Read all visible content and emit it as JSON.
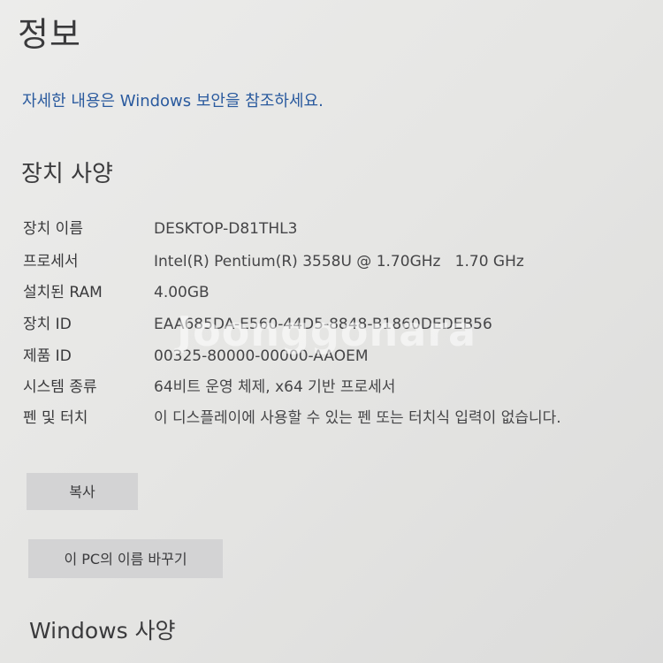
{
  "header": {
    "title": "정보",
    "security_link": "자세한 내용은 Windows 보안을 참조하세요."
  },
  "device_specs": {
    "title": "장치 사양",
    "rows": [
      {
        "label": "장치 이름",
        "value": "DESKTOP-D81THL3"
      },
      {
        "label": "프로세서",
        "value": "Intel(R) Pentium(R) 3558U @ 1.70GHz   1.70 GHz"
      },
      {
        "label": "설치된 RAM",
        "value": "4.00GB"
      },
      {
        "label": "장치 ID",
        "value": "EAA685DA-E560-44D5-8848-B1860DEDEB56"
      },
      {
        "label": "제품 ID",
        "value": "00325-80000-00000-AAOEM"
      },
      {
        "label": "시스템 종류",
        "value": "64비트 운영 체제, x64 기반 프로세서"
      },
      {
        "label": "펜 및 터치",
        "value": "이 디스플레이에 사용할 수 있는 펜 또는 터치식 입력이 없습니다."
      }
    ]
  },
  "buttons": {
    "copy": "복사",
    "rename": "이 PC의 이름 바꾸기"
  },
  "windows_specs": {
    "title": "Windows 사양"
  },
  "watermark": {
    "text": "Joonggonara"
  }
}
